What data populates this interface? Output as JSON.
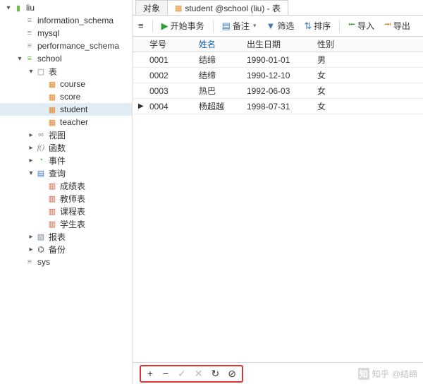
{
  "tree": [
    {
      "indent": 0,
      "arrow": "▾",
      "icon": "server",
      "iconClass": "ic-dbopen",
      "label": "liu"
    },
    {
      "indent": 1,
      "arrow": "",
      "icon": "db",
      "iconClass": "ic-db",
      "label": "information_schema"
    },
    {
      "indent": 1,
      "arrow": "",
      "icon": "db",
      "iconClass": "ic-db",
      "label": "mysql"
    },
    {
      "indent": 1,
      "arrow": "",
      "icon": "db",
      "iconClass": "ic-db",
      "label": "performance_schema"
    },
    {
      "indent": 1,
      "arrow": "▾",
      "icon": "db",
      "iconClass": "ic-dbopen",
      "label": "school"
    },
    {
      "indent": 2,
      "arrow": "▾",
      "icon": "folder",
      "iconClass": "ic-folder",
      "label": "表"
    },
    {
      "indent": 3,
      "arrow": "",
      "icon": "table",
      "iconClass": "ic-table",
      "label": "course"
    },
    {
      "indent": 3,
      "arrow": "",
      "icon": "table",
      "iconClass": "ic-table",
      "label": "score"
    },
    {
      "indent": 3,
      "arrow": "",
      "icon": "table",
      "iconClass": "ic-table",
      "label": "student",
      "selected": true
    },
    {
      "indent": 3,
      "arrow": "",
      "icon": "table",
      "iconClass": "ic-table",
      "label": "teacher"
    },
    {
      "indent": 2,
      "arrow": "▸",
      "icon": "view",
      "iconClass": "ic-view",
      "label": "视图"
    },
    {
      "indent": 2,
      "arrow": "▸",
      "icon": "fn",
      "iconClass": "ic-fn",
      "label": "函数"
    },
    {
      "indent": 2,
      "arrow": "▸",
      "icon": "evt",
      "iconClass": "ic-evt",
      "label": "事件"
    },
    {
      "indent": 2,
      "arrow": "▾",
      "icon": "qry",
      "iconClass": "ic-qry",
      "label": "查询"
    },
    {
      "indent": 3,
      "arrow": "",
      "icon": "qfile",
      "iconClass": "ic-qfile",
      "label": "成绩表"
    },
    {
      "indent": 3,
      "arrow": "",
      "icon": "qfile",
      "iconClass": "ic-qfile",
      "label": "教师表"
    },
    {
      "indent": 3,
      "arrow": "",
      "icon": "qfile",
      "iconClass": "ic-qfile",
      "label": "课程表"
    },
    {
      "indent": 3,
      "arrow": "",
      "icon": "qfile",
      "iconClass": "ic-qfile",
      "label": "学生表"
    },
    {
      "indent": 2,
      "arrow": "▸",
      "icon": "rpt",
      "iconClass": "ic-rpt",
      "label": "报表"
    },
    {
      "indent": 2,
      "arrow": "▸",
      "icon": "bkp",
      "iconClass": "ic-bkp",
      "label": "备份"
    },
    {
      "indent": 1,
      "arrow": "",
      "icon": "db",
      "iconClass": "ic-db",
      "label": "sys"
    }
  ],
  "tabs": {
    "objects": "对象",
    "active_icon": "table",
    "active_label": "student @school (liu) - 表"
  },
  "toolbar": {
    "menu_icon": "≡",
    "begin_tx": "开始事务",
    "remark": "备注",
    "filter": "筛选",
    "sort": "排序",
    "import": "导入",
    "export": "导出"
  },
  "grid": {
    "columns": [
      "学号",
      "姓名",
      "出生日期",
      "性别"
    ],
    "sort_col": 1,
    "rows": [
      {
        "mark": "",
        "cells": [
          "0001",
          "结缔",
          "1990-01-01",
          "男"
        ]
      },
      {
        "mark": "",
        "cells": [
          "0002",
          "结缔",
          "1990-12-10",
          "女"
        ]
      },
      {
        "mark": "",
        "cells": [
          "0003",
          "热巴",
          "1992-06-03",
          "女"
        ]
      },
      {
        "mark": "▶",
        "cells": [
          "0004",
          "杨超越",
          "1998-07-31",
          "女"
        ]
      }
    ]
  },
  "navbar": {
    "add": "+",
    "remove": "−",
    "commit": "✓",
    "cancel": "✕",
    "refresh": "↻",
    "stop": "⊘"
  },
  "watermark": {
    "logo": "知",
    "site": "知乎",
    "author": "@结缔"
  },
  "iconGlyph": {
    "server": "▮",
    "db": "≡",
    "folder": "▢",
    "table": "▦",
    "view": "∞",
    "fn": "f()",
    "evt": "◔",
    "qry": "▤",
    "qfile": "▥",
    "rpt": "▧",
    "bkp": "⌬"
  }
}
